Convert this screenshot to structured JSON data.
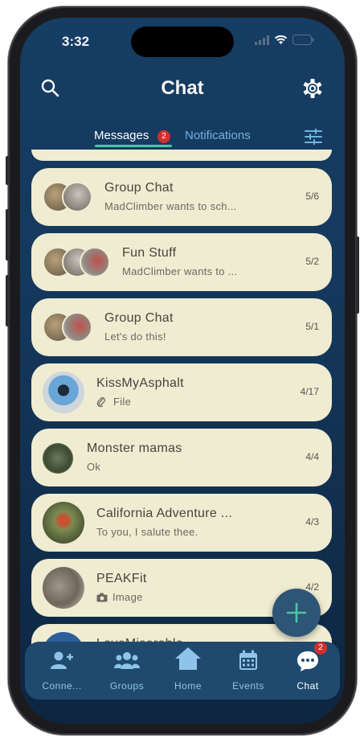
{
  "status_bar": {
    "time": "3:32"
  },
  "header": {
    "title": "Chat"
  },
  "tabs": [
    {
      "label": "Messages",
      "badge": "2",
      "active": true
    },
    {
      "label": "Notifications",
      "active": false
    }
  ],
  "conversations": [
    {
      "name": "Group Chat",
      "preview": "MadClimber wants to sch...",
      "date": "5/6"
    },
    {
      "name": "Fun Stuff",
      "preview": "MadClimber wants to ...",
      "date": "5/2"
    },
    {
      "name": "Group Chat",
      "preview": "Let's do this!",
      "date": "5/1"
    },
    {
      "name": "KissMyAsphalt",
      "preview": "File",
      "date": "4/17"
    },
    {
      "name": "Monster mamas",
      "preview": "Ok",
      "date": "4/4"
    },
    {
      "name": "California Adventure ...",
      "preview": "To you, I salute thee.",
      "date": "4/3"
    },
    {
      "name": "PEAKFit",
      "preview": "Image",
      "date": "4/2"
    },
    {
      "name": "LoveMiserable",
      "preview": "",
      "date": ""
    }
  ],
  "bottom_nav": [
    {
      "label": "Conne...",
      "icon": "connections-icon"
    },
    {
      "label": "Groups",
      "icon": "groups-icon"
    },
    {
      "label": "Home",
      "icon": "home-icon"
    },
    {
      "label": "Events",
      "icon": "calendar-icon"
    },
    {
      "label": "Chat",
      "icon": "chat-icon",
      "badge": "2",
      "active": true
    }
  ],
  "colors": {
    "background": "#15395d",
    "card": "#efecd2",
    "accent": "#4fc3a8",
    "badge": "#d32f2f",
    "nav_bar": "#1f4a6e"
  }
}
